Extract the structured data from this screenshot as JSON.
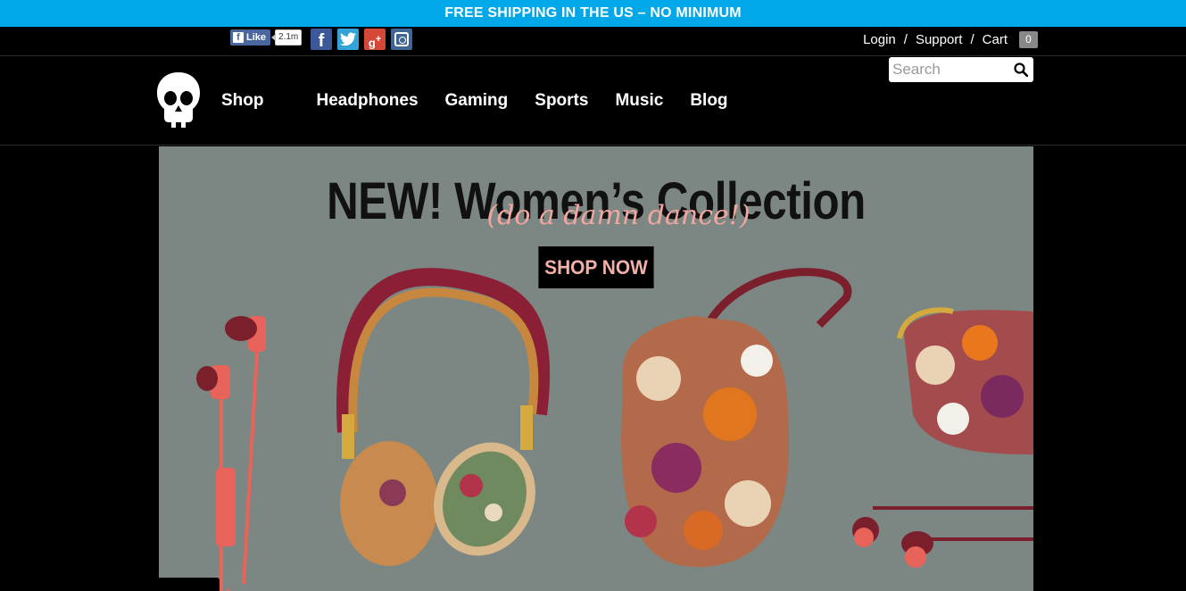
{
  "promo": {
    "text": "FREE SHIPPING IN THE US – NO MINIMUM"
  },
  "social": {
    "like_label": "Like",
    "like_count": "2.1m",
    "icons": [
      "facebook-icon",
      "twitter-icon",
      "google-plus-icon",
      "instagram-icon"
    ]
  },
  "account": {
    "login": "Login",
    "support": "Support",
    "cart": "Cart",
    "cart_count": "0",
    "separator": "/"
  },
  "nav": {
    "items": [
      "Shop",
      "Headphones",
      "Gaming",
      "Sports",
      "Music",
      "Blog"
    ]
  },
  "search": {
    "placeholder": "Search"
  },
  "hero": {
    "title": "NEW! Women’s Collection",
    "script": "(do a damn dance!)",
    "cta": "SHOP NOW"
  },
  "colors": {
    "promo_bg": "#00a8e8",
    "hero_bg": "#7c8783",
    "accent_coral": "#f1b0a8"
  }
}
